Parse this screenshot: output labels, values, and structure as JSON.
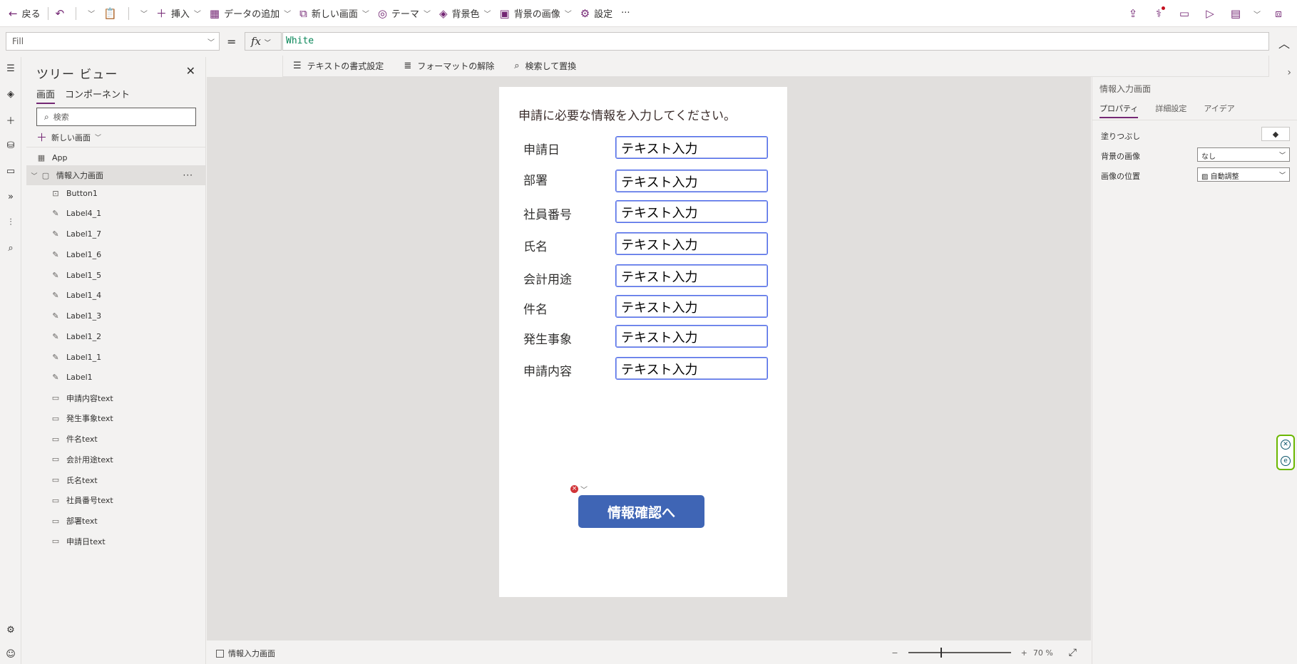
{
  "command_bar": {
    "back": "戻る",
    "insert": "挿入",
    "add_data": "データの追加",
    "new_screen": "新しい画面",
    "theme": "テーマ",
    "background_color": "背景色",
    "background_image": "背景の画像",
    "settings": "設定",
    "more": "···"
  },
  "formula_bar": {
    "property": "Fill",
    "equals": "=",
    "fx": "fx",
    "formula": "White",
    "format_text": "テキストの書式設定",
    "remove_format": "フォーマットの解除",
    "find_replace": "検索して置換"
  },
  "tree_view": {
    "title": "ツリー ビュー",
    "tabs": [
      "画面",
      "コンポーネント"
    ],
    "search_placeholder": "検索",
    "new_screen": "新しい画面",
    "app_node": "App",
    "screen_node": "情報入力画面",
    "screen_more": "···",
    "children": [
      {
        "label": "Button1",
        "kind": "button"
      },
      {
        "label": "Label4_1",
        "kind": "label"
      },
      {
        "label": "Label1_7",
        "kind": "label"
      },
      {
        "label": "Label1_6",
        "kind": "label"
      },
      {
        "label": "Label1_5",
        "kind": "label"
      },
      {
        "label": "Label1_4",
        "kind": "label"
      },
      {
        "label": "Label1_3",
        "kind": "label"
      },
      {
        "label": "Label1_2",
        "kind": "label"
      },
      {
        "label": "Label1_1",
        "kind": "label"
      },
      {
        "label": "Label1",
        "kind": "label"
      },
      {
        "label": "申請内容text",
        "kind": "textinput"
      },
      {
        "label": "発生事象text",
        "kind": "textinput"
      },
      {
        "label": "件名text",
        "kind": "textinput"
      },
      {
        "label": "会計用途text",
        "kind": "textinput"
      },
      {
        "label": "氏名text",
        "kind": "textinput"
      },
      {
        "label": "社員番号text",
        "kind": "textinput"
      },
      {
        "label": "部署text",
        "kind": "textinput"
      },
      {
        "label": "申請日text",
        "kind": "textinput"
      }
    ]
  },
  "form": {
    "heading": "申請に必要な情報を入力してください。",
    "fields": [
      {
        "label": "申請日",
        "value": "テキスト入力"
      },
      {
        "label": "部署",
        "value": "テキスト入力"
      },
      {
        "label": "社員番号",
        "value": "テキスト入力"
      },
      {
        "label": "氏名",
        "value": "テキスト入力"
      },
      {
        "label": "会計用途",
        "value": "テキスト入力"
      },
      {
        "label": "件名",
        "value": "テキスト入力"
      },
      {
        "label": "発生事象",
        "value": "テキスト入力"
      },
      {
        "label": "申請内容",
        "value": "テキスト入力"
      }
    ],
    "submit_button": "情報確認へ"
  },
  "status_bar": {
    "screen_name": "情報入力画面",
    "zoom_minus": "−",
    "zoom_plus": "+",
    "zoom_value": "70",
    "zoom_unit": "%"
  },
  "properties": {
    "title": "情報入力画面",
    "tabs": [
      "プロパティ",
      "詳細設定",
      "アイデア"
    ],
    "fill_label": "塗りつぶし",
    "bg_image_label": "背景の画像",
    "bg_image_value": "なし",
    "image_pos_label": "画像の位置",
    "image_pos_value": "自動調整"
  },
  "colors": {
    "accent": "#742774",
    "button": "#3f65b5",
    "input_border": "#4f6bed",
    "error": "#d13438"
  }
}
